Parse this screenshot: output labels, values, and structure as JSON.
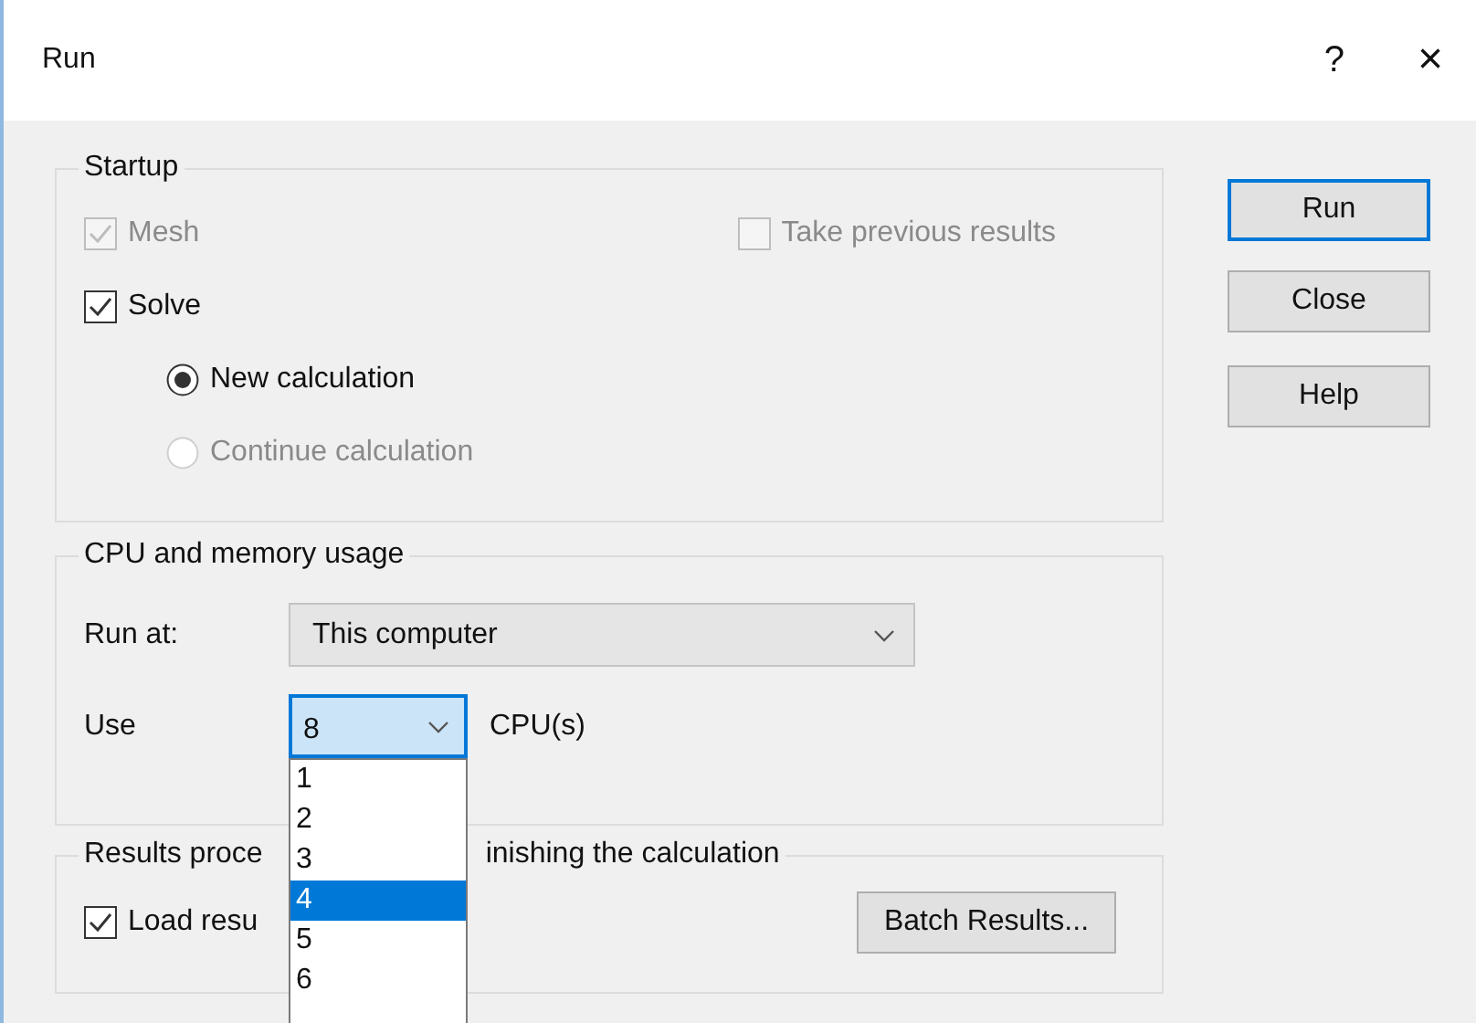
{
  "window": {
    "title": "Run",
    "help": "?",
    "close": "×"
  },
  "startup": {
    "legend": "Startup",
    "rows": [
      {
        "items": [
          {
            "kind": "checkbox",
            "label": "Mesh",
            "checked": true,
            "disabled": true
          },
          {
            "kind": "checkbox",
            "label": "Take previous results",
            "checked": false,
            "disabled": true
          }
        ]
      },
      {
        "items": [
          {
            "kind": "checkbox",
            "label": "Solve",
            "checked": true,
            "disabled": false
          }
        ]
      },
      {
        "items": [
          {
            "kind": "radio",
            "label": "New calculation",
            "selected": true,
            "disabled": false
          }
        ]
      },
      {
        "items": [
          {
            "kind": "radio",
            "label": "Continue calculation",
            "selected": false,
            "disabled": true
          }
        ]
      }
    ]
  },
  "cpu": {
    "legend": "CPU and memory usage",
    "run_at": {
      "label": "Run at:",
      "value": "This computer"
    },
    "use": {
      "label": "Use",
      "value": "8",
      "unit": "CPU(s)",
      "expanded": true
    },
    "options": [
      {
        "label": "1",
        "selected": false
      },
      {
        "label": "2",
        "selected": false
      },
      {
        "label": "3",
        "selected": false
      },
      {
        "label": "4",
        "selected": true
      },
      {
        "label": "5",
        "selected": false
      },
      {
        "label": "6",
        "selected": false
      }
    ]
  },
  "results": {
    "legend_parts": [
      "Results proce",
      "inishing the calculation"
    ],
    "load": {
      "label": "Load resu",
      "checked": true
    },
    "batch_button": "Batch Results..."
  },
  "buttons": [
    {
      "label": "Run",
      "default": true
    },
    {
      "label": "Close",
      "default": false
    },
    {
      "label": "Help",
      "default": false
    }
  ]
}
